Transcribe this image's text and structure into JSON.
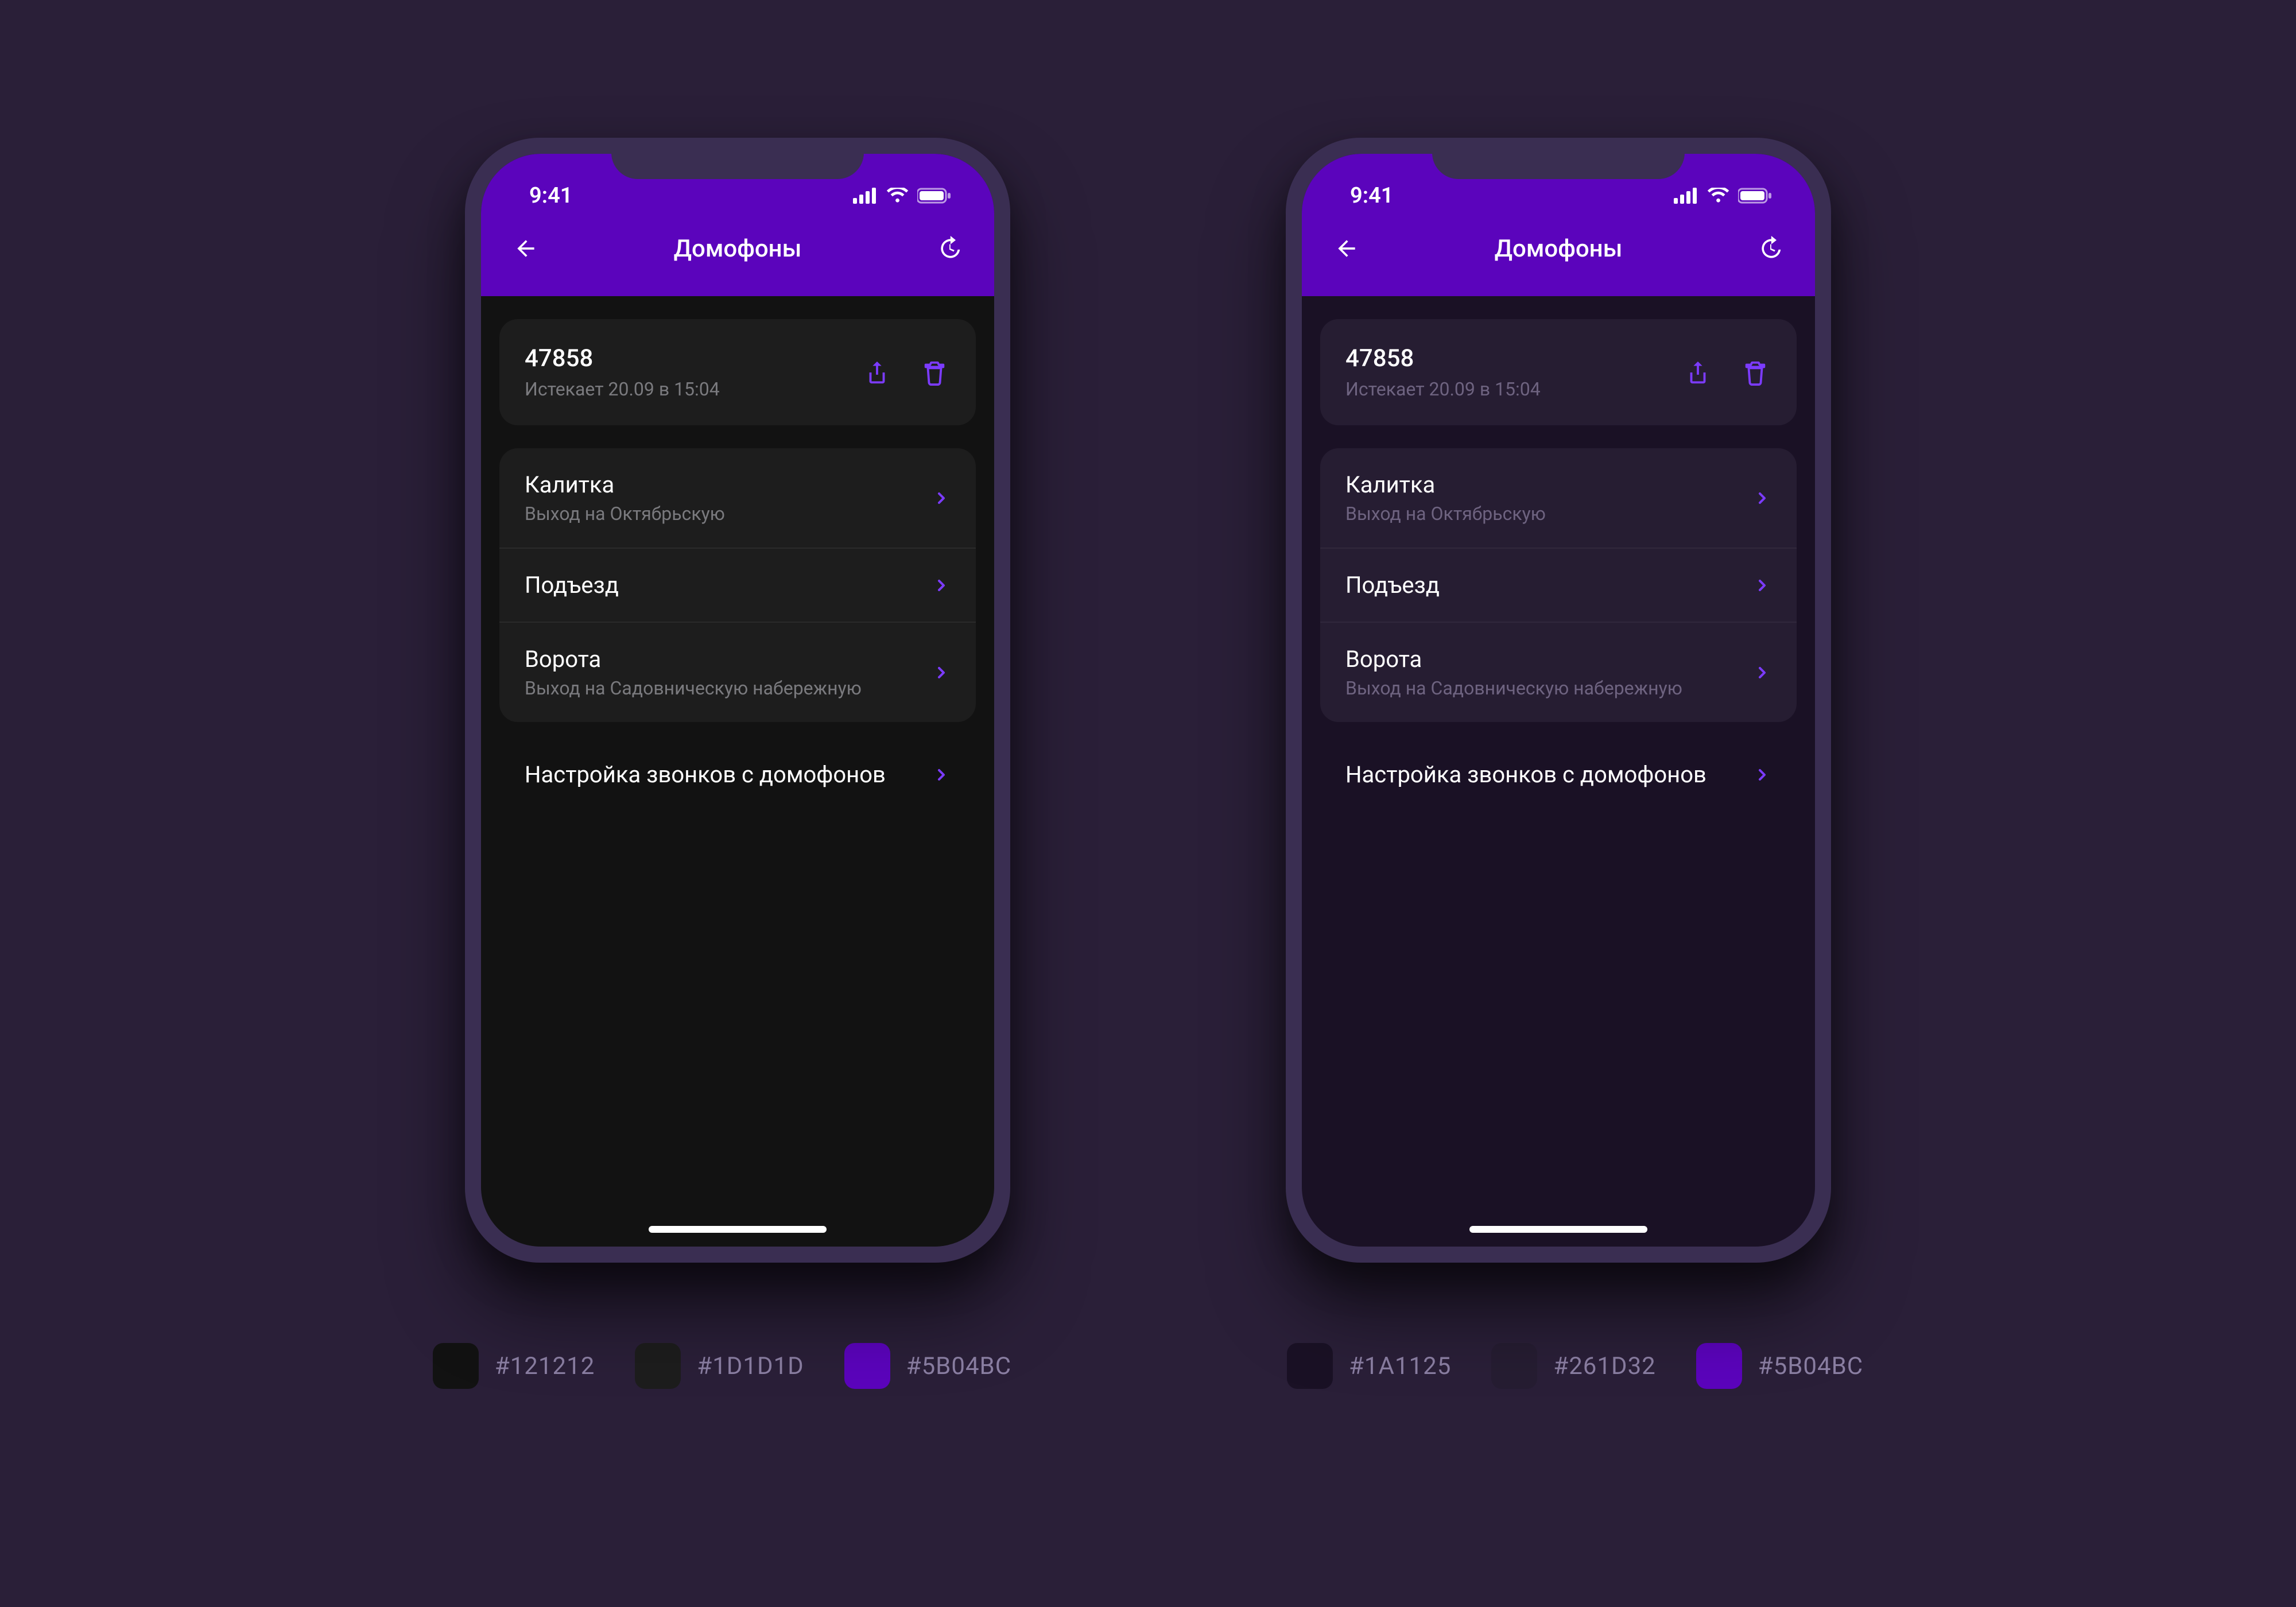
{
  "status": {
    "time": "9:41"
  },
  "nav": {
    "title": "Домофоны"
  },
  "code_card": {
    "code": "47858",
    "expiry": "Истекает 20.09 в 15:04"
  },
  "doors": [
    {
      "title": "Калитка",
      "sub": "Выход на Октябрьскую"
    },
    {
      "title": "Подъезд",
      "sub": ""
    },
    {
      "title": "Ворота",
      "sub": "Выход на Садовническую набережную"
    }
  ],
  "settings_link": "Настройка звонков с домофонов",
  "palettes": {
    "a": [
      {
        "hex": "#121212"
      },
      {
        "hex": "#1D1D1D"
      },
      {
        "hex": "#5B04BC"
      }
    ],
    "b": [
      {
        "hex": "#1A1125"
      },
      {
        "hex": "#261D32"
      },
      {
        "hex": "#5B04BC"
      }
    ]
  },
  "colors": {
    "accent": "#5B04BC",
    "action_icon": "#7C3BFF"
  }
}
